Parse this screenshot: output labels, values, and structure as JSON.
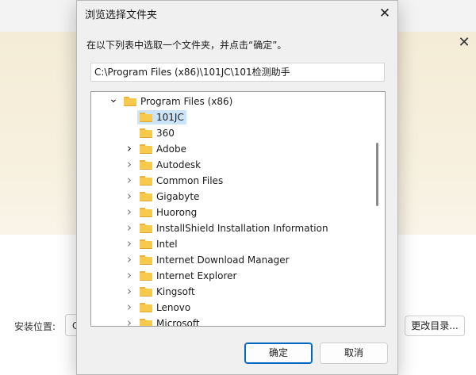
{
  "background": {
    "close_glyph": "✕",
    "install_location_label": "安装位置:",
    "path_value_visible": "C",
    "change_dir_button": "更改目录..."
  },
  "dialog": {
    "title": "浏览选择文件夹",
    "close_glyph": "✕",
    "prompt": "在以下列表中选取一个文件夹，并点击“确定”。",
    "path_value": "C:\\Program Files (x86)\\101JC\\101检测助手",
    "ok_label": "确定",
    "cancel_label": "取消"
  },
  "tree": {
    "items": [
      {
        "label": "Program Files (x86)",
        "depth": 0,
        "expander": "expanded",
        "selected": false
      },
      {
        "label": "101JC",
        "depth": 1,
        "expander": "none",
        "selected": true
      },
      {
        "label": "360",
        "depth": 1,
        "expander": "none",
        "selected": false
      },
      {
        "label": "Adobe",
        "depth": 1,
        "expander": "collapsed-dark",
        "selected": false
      },
      {
        "label": "Autodesk",
        "depth": 1,
        "expander": "collapsed",
        "selected": false
      },
      {
        "label": "Common Files",
        "depth": 1,
        "expander": "collapsed",
        "selected": false
      },
      {
        "label": "Gigabyte",
        "depth": 1,
        "expander": "collapsed",
        "selected": false
      },
      {
        "label": "Huorong",
        "depth": 1,
        "expander": "collapsed",
        "selected": false
      },
      {
        "label": "InstallShield Installation Information",
        "depth": 1,
        "expander": "collapsed",
        "selected": false
      },
      {
        "label": "Intel",
        "depth": 1,
        "expander": "collapsed",
        "selected": false
      },
      {
        "label": "Internet Download Manager",
        "depth": 1,
        "expander": "collapsed",
        "selected": false
      },
      {
        "label": "Internet Explorer",
        "depth": 1,
        "expander": "collapsed",
        "selected": false
      },
      {
        "label": "Kingsoft",
        "depth": 1,
        "expander": "collapsed",
        "selected": false
      },
      {
        "label": "Lenovo",
        "depth": 1,
        "expander": "collapsed",
        "selected": false
      },
      {
        "label": "Microsoft",
        "depth": 1,
        "expander": "collapsed",
        "selected": false
      }
    ]
  },
  "icons": {
    "folder": "folder-icon",
    "expanded": "chevron-down-icon",
    "collapsed": "chevron-right-icon"
  },
  "colors": {
    "selection": "#cce4f7",
    "folder": "#f7c94c",
    "accent": "#0067c0"
  }
}
